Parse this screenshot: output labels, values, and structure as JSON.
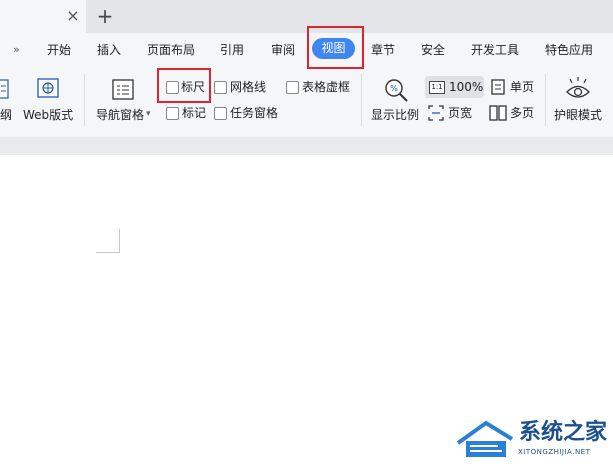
{
  "tabs": {
    "close_glyph": "×",
    "new_glyph": "+"
  },
  "menu": {
    "arrow": "»",
    "items": [
      "开始",
      "插入",
      "页面布局",
      "引用",
      "审阅",
      "视图",
      "章节",
      "安全",
      "开发工具",
      "特色应用"
    ],
    "active": "视图"
  },
  "ribbon": {
    "outline_label": "纲",
    "web_label": "Web版式",
    "nav_label": "导航窗格",
    "nav_arrow": "▾",
    "ruler_label": "标尺",
    "grid_label": "网格线",
    "table_border_label": "表格虚框",
    "mark_label": "标记",
    "task_pane_label": "任务窗格",
    "ruler_checked": false,
    "grid_checked": false,
    "table_border_checked": false,
    "mark_checked": false,
    "task_pane_checked": false,
    "zoom_ratio_label": "显示比例",
    "zoom_icon_text": "1:1",
    "zoom_value": "100%",
    "page_width_label": "页宽",
    "single_page_label": "单页",
    "multi_page_label": "多页",
    "eye_mode_label": "护眼模式"
  },
  "watermark": {
    "title": "系统之家",
    "subtitle": "XITONGZHIJIA.NET"
  },
  "colors": {
    "accent": "#3f86f0",
    "highlight": "#e0242f",
    "watermark": "#1c4f8f"
  }
}
